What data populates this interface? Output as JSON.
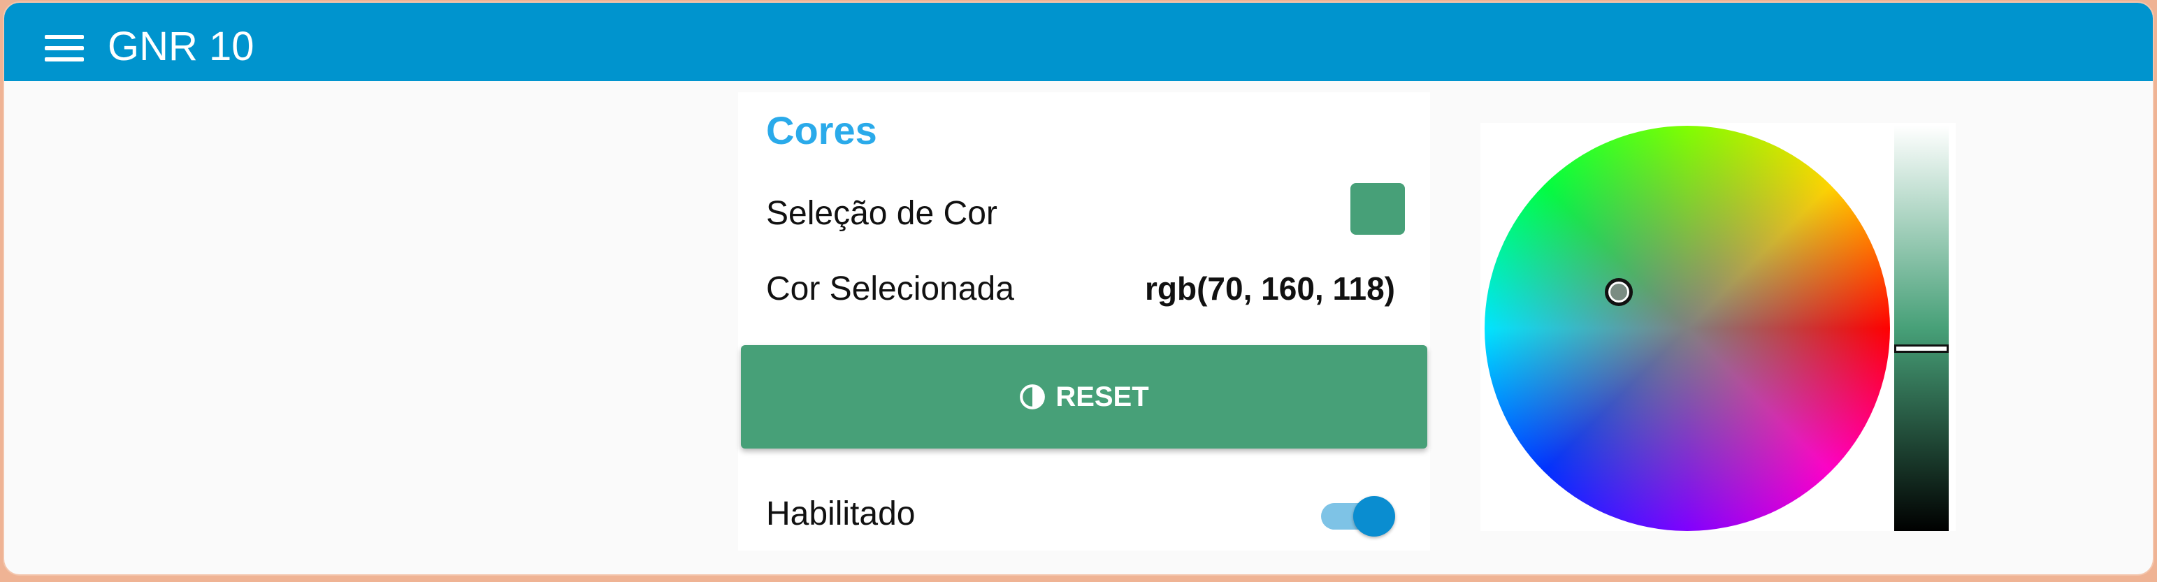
{
  "header": {
    "title": "GNR 10",
    "menu_icon": "hamburger-menu-icon"
  },
  "group": {
    "title": "Cores",
    "color_selection_label": "Seleção de Cor",
    "swatch_color": "#47a078",
    "selected_color_label": "Cor Selecionada",
    "selected_color_value": "rgb(70, 160, 118)",
    "reset_button_label": "RESET",
    "reset_icon": "contrast-icon",
    "enabled_label": "Habilitado",
    "enabled_value": true
  },
  "colors": {
    "header_bg": "#0094ce",
    "accent_title": "#2aaaea",
    "button_bg": "#47a078",
    "toggle_on": "#0a8dd0",
    "outer_frame": "#efb394"
  },
  "picker": {
    "selected_rgb": [
      70,
      160,
      118
    ],
    "brightness_level": 0.55
  }
}
